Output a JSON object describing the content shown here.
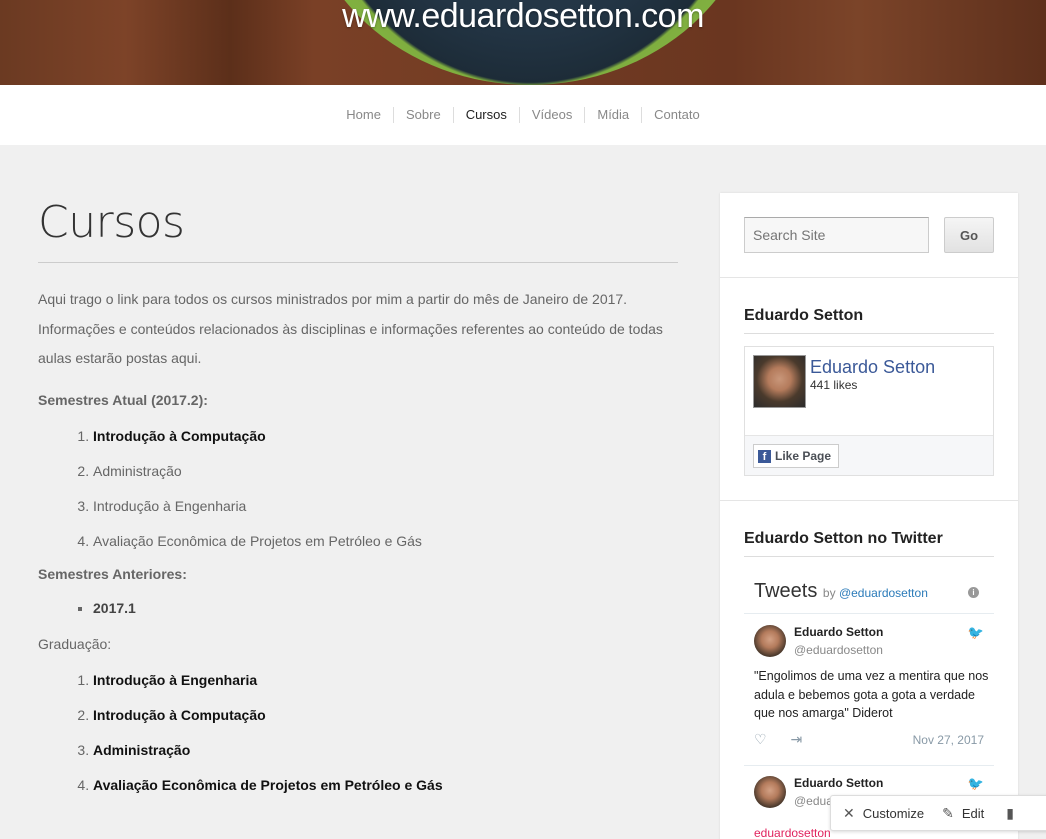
{
  "site": {
    "title": "www.eduardosetton.com"
  },
  "nav": {
    "items": [
      "Home",
      "Sobre",
      "Cursos",
      "Vídeos",
      "Mídia",
      "Contato"
    ],
    "active": "Cursos"
  },
  "page": {
    "title": "Cursos",
    "intro": "Aqui trago o link para todos os cursos ministrados por mim a partir do mês de Janeiro de 2017. Informações e conteúdos relacionados às disciplinas e informações referentes ao conteúdo de todas aulas estarão postas aqui.",
    "current_heading": "Semestres Atual (2017.2):",
    "current_courses": [
      {
        "label": "Introdução à Computação",
        "link": true
      },
      {
        "label": "Administração",
        "link": false
      },
      {
        "label": "Introdução à Engenharia",
        "link": false
      },
      {
        "label": "Avaliação Econômica de Projetos em Petróleo e Gás",
        "link": false
      }
    ],
    "previous_heading": "Semestres Anteriores:",
    "previous_items": [
      "2017.1"
    ],
    "grad_label": "Graduação:",
    "grad_courses": [
      {
        "label": "Introdução à Engenharia"
      },
      {
        "label": "Introdução à Computação"
      },
      {
        "label": "Administração"
      },
      {
        "label": "Avaliação Econômica de Projetos em Petróleo e Gás"
      }
    ]
  },
  "sidebar": {
    "search": {
      "placeholder": "Search Site",
      "button": "Go"
    },
    "facebook": {
      "title": "Eduardo Setton",
      "name": "Eduardo Setton",
      "likes": "441 likes",
      "like_button": "Like Page"
    },
    "twitter": {
      "title": "Eduardo Setton no Twitter",
      "header": "Tweets",
      "by": "by",
      "handle": "@eduardosetton",
      "tweets": [
        {
          "author": "Eduardo Setton",
          "handle": "@eduardosetton",
          "text": "\"Engolimos de uma vez a mentira que nos adula e bebemos gota a gota a verdade que nos amarga\" Diderot",
          "date": "Nov 27, 2017"
        },
        {
          "author": "Eduardo Setton",
          "handle": "@edua",
          "footer": "eduardosetton"
        }
      ]
    }
  },
  "admin_bar": {
    "customize": "Customize",
    "edit": "Edit"
  },
  "colors": {
    "facebook": "#3b5998",
    "twitter_link": "#2b7bb9",
    "background": "#f0f0f0"
  }
}
